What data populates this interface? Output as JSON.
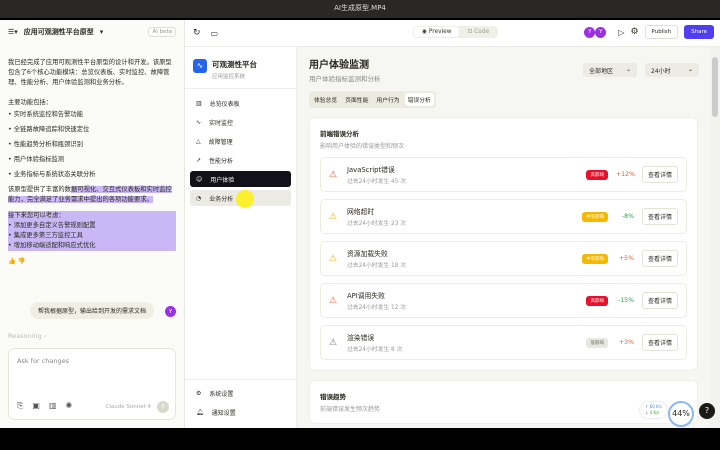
{
  "window_title": "AI生成原型.MP4",
  "chat": {
    "project_title": "应用可观测性平台原型",
    "beta": "AI beta",
    "intro": "我已经完成了应用可观测性平台原型的设计和开发。该原型包含了6个核心功能模块：总览仪表板、实时监控、故障管理、性能分析、用户体验监测和业务分析。",
    "features_title": "主要功能包括：",
    "features": [
      "实时系统监控和告警功能",
      "全链路故障追踪和快速定位",
      "性能趋势分析和瓶颈识别",
      "用户体验指标监测",
      "业务指标与系统状态关联分析"
    ],
    "summary_a": "该原型提供了丰富的数",
    "summary_b": "据可视化、交互式仪表板和实时监控能力，完全满足了业务需求中提出的各项功能要求。",
    "next_title": "接下来您可以考虑：",
    "next": [
      "• 添加更多自定义告警规则配置",
      "• 集成更多第三方监控工具",
      "• 增加移动端适配和响应式优化"
    ],
    "user_msg": "帮我根据原型，输出给到开发的需求文档",
    "user_avatar": "Y",
    "reasoning": "Reasoning ›",
    "input_placeholder": "Ask for changes",
    "model": "Claude Sonnet 4"
  },
  "toolbar": {
    "preview": "Preview",
    "code": "Code",
    "avatars": [
      "Y",
      "Y"
    ],
    "publish": "Publish",
    "share": "Share"
  },
  "sidebar": {
    "brand": "可观测性平台",
    "brand_sub": "应用监控系统",
    "items": [
      {
        "icon": "bar-chart",
        "label": "总览仪表板"
      },
      {
        "icon": "activity",
        "label": "实时监控"
      },
      {
        "icon": "warning",
        "label": "故障管理"
      },
      {
        "icon": "trend",
        "label": "性能分析"
      },
      {
        "icon": "users",
        "label": "用户体验"
      },
      {
        "icon": "pie",
        "label": "业务分析"
      }
    ],
    "bottom": [
      {
        "icon": "gear",
        "label": "系统设置"
      },
      {
        "icon": "bell",
        "label": "通知设置"
      }
    ]
  },
  "main": {
    "title": "用户体验监测",
    "subtitle": "用户体验指标监测和分析",
    "region": "全部地区",
    "range": "24小时",
    "tabs": [
      "体验总览",
      "页面性能",
      "用户行为",
      "错误分析"
    ],
    "errors_title": "前端错误分析",
    "errors_sub": "影响用户体验的错误类型和频次",
    "errors": [
      {
        "name": "JavaScript错误",
        "desc": "过去24小时发生 45 次",
        "badge": "高影响",
        "badge_color": "#e8102a",
        "change": "+12%",
        "change_color": "#e85d30"
      },
      {
        "name": "网络超时",
        "desc": "过去24小时发生 23 次",
        "badge": "中等影响",
        "badge_color": "#f5b800",
        "change": "-8%",
        "change_color": "#22aa44"
      },
      {
        "name": "资源加载失败",
        "desc": "过去24小时发生 18 次",
        "badge": "中等影响",
        "badge_color": "#f5b800",
        "change": "+5%",
        "change_color": "#e85d30"
      },
      {
        "name": "API调用失败",
        "desc": "过去24小时发生 12 次",
        "badge": "高影响",
        "badge_color": "#e8102a",
        "change": "-15%",
        "change_color": "#22aa44"
      },
      {
        "name": "渲染错误",
        "desc": "过去24小时发生 8 次",
        "badge": "低影响",
        "badge_color": "#e8e8e0",
        "change": "+3%",
        "change_color": "#e85d30"
      }
    ],
    "detail_label": "查看详情",
    "trend_title": "错误趋势",
    "trend_sub": "前端错误发生频次趋势"
  },
  "overlay": {
    "up": "↑ 60 K/s",
    "down": "↓ 4 K/s",
    "cpu": "44%",
    "help": "?"
  }
}
